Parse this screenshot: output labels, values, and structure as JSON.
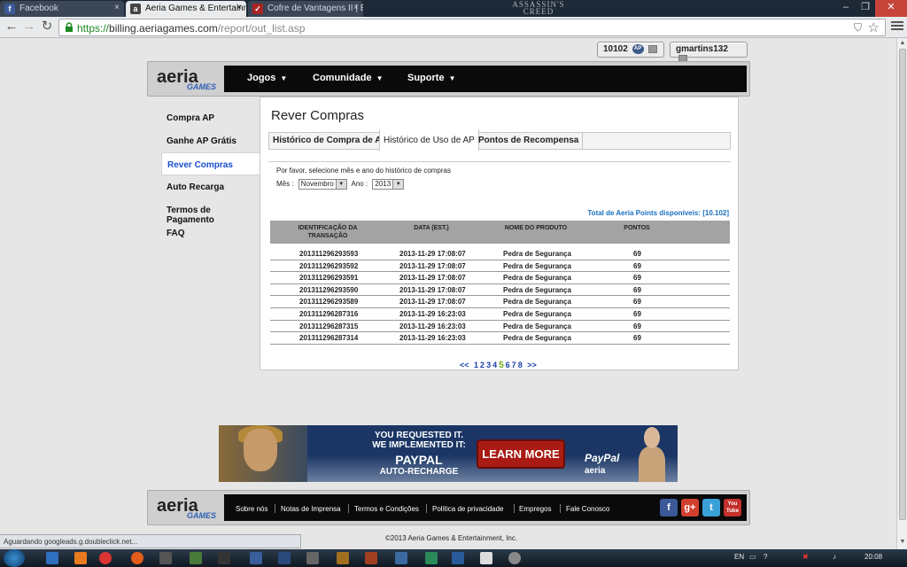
{
  "browser": {
    "tabs": [
      {
        "label": "Facebook",
        "icon": "facebook-icon",
        "close": "×"
      },
      {
        "label": "Aeria Games & Entertainme",
        "icon": "aeria-icon",
        "close": "×"
      },
      {
        "label": "Cofre de Vantagens II | Edi",
        "icon": "ac-icon",
        "close": "×"
      }
    ],
    "ac_logo": "ASSASSIN'S CREED",
    "url_scheme": "https://",
    "url_host": "billing.aeriagames.com",
    "url_path": "/report/out_list.asp",
    "status_text": "Aguardando googleads.g.doubleclick.net..."
  },
  "account": {
    "points": "10102",
    "ap_badge": "AP",
    "username": "gmartins132"
  },
  "nav": {
    "logo_main": "aeria",
    "logo_sub": "GAMES",
    "items": [
      {
        "label": "Jogos"
      },
      {
        "label": "Comunidade"
      },
      {
        "label": "Suporte"
      }
    ]
  },
  "sidebar": {
    "items": [
      {
        "label": "Compra AP"
      },
      {
        "label": "Ganhe AP Grátis"
      },
      {
        "label": "Rever Compras"
      },
      {
        "label": "Auto Recarga"
      },
      {
        "label": "Termos de Pagamento"
      },
      {
        "label": "FAQ"
      }
    ]
  },
  "content": {
    "title": "Rever Compras",
    "tabs": [
      {
        "label": "Histórico de Compra de AP"
      },
      {
        "label": "Histórico de Uso de AP"
      },
      {
        "label": "Pontos de Recompensa"
      }
    ],
    "prompt": "Por favor, selecione mês e ano do histórico de compras",
    "month_label": "Mês :",
    "month_value": "Novembro",
    "year_label": "Ano :",
    "year_value": "2013",
    "total_label": "Total de Aeria Points disponíveis:",
    "total_value": "[10.102]",
    "columns": [
      "IDENTIFICAÇÃO DA TRANSAÇÃO",
      "DATA (EST.)",
      "NOME DO PRODUTO",
      "PONTOS"
    ],
    "rows": [
      {
        "id": "201311296293593",
        "date": "2013-11-29 17:08:07",
        "product": "Pedra de Segurança",
        "points": "69"
      },
      {
        "id": "201311296293592",
        "date": "2013-11-29 17:08:07",
        "product": "Pedra de Segurança",
        "points": "69"
      },
      {
        "id": "201311296293591",
        "date": "2013-11-29 17:08:07",
        "product": "Pedra de Segurança",
        "points": "69"
      },
      {
        "id": "201311296293590",
        "date": "2013-11-29 17:08:07",
        "product": "Pedra de Segurança",
        "points": "69"
      },
      {
        "id": "201311296293589",
        "date": "2013-11-29 17:08:07",
        "product": "Pedra de Segurança",
        "points": "69"
      },
      {
        "id": "201311296287316",
        "date": "2013-11-29 16:23:03",
        "product": "Pedra de Segurança",
        "points": "69"
      },
      {
        "id": "201311296287315",
        "date": "2013-11-29 16:23:03",
        "product": "Pedra de Segurança",
        "points": "69"
      },
      {
        "id": "201311296287314",
        "date": "2013-11-29 16:23:03",
        "product": "Pedra de Segurança",
        "points": "69"
      }
    ],
    "pager": {
      "prev": "<<",
      "pages": [
        "1",
        "2",
        "3",
        "4",
        "5",
        "6",
        "7",
        "8"
      ],
      "current": "5",
      "next": ">>"
    }
  },
  "banner": {
    "line1": "YOU REQUESTED IT.",
    "line1b": "WE IMPLEMENTED IT:",
    "line2": "PAYPAL",
    "line3": "AUTO-RECHARGE",
    "cta": "LEARN MORE",
    "paypal": "PayPal",
    "aeria": "aeria"
  },
  "footer": {
    "links": [
      "Sobre nós",
      "Notas de Imprensa",
      "Termos e Condições",
      "Política de privacidade",
      "Empregos",
      "Fale Conosco"
    ],
    "social": [
      {
        "label": "f",
        "icon": "facebook-icon",
        "color": "#3b5998"
      },
      {
        "label": "g+",
        "icon": "google-plus-icon",
        "color": "#d23f2f"
      },
      {
        "label": "t",
        "icon": "twitter-icon",
        "color": "#3aa0d8"
      },
      {
        "label": "You Tube",
        "icon": "youtube-icon",
        "color": "#c4302b"
      }
    ],
    "copyright": "©2013 Aeria Games & Entertainment, Inc."
  },
  "taskbar": {
    "lang": "EN",
    "clock": "20:08"
  },
  "colors": {
    "link_blue": "#1a4fd0",
    "pager_current": "#66a80a",
    "total_blue": "#1a6fc0"
  }
}
